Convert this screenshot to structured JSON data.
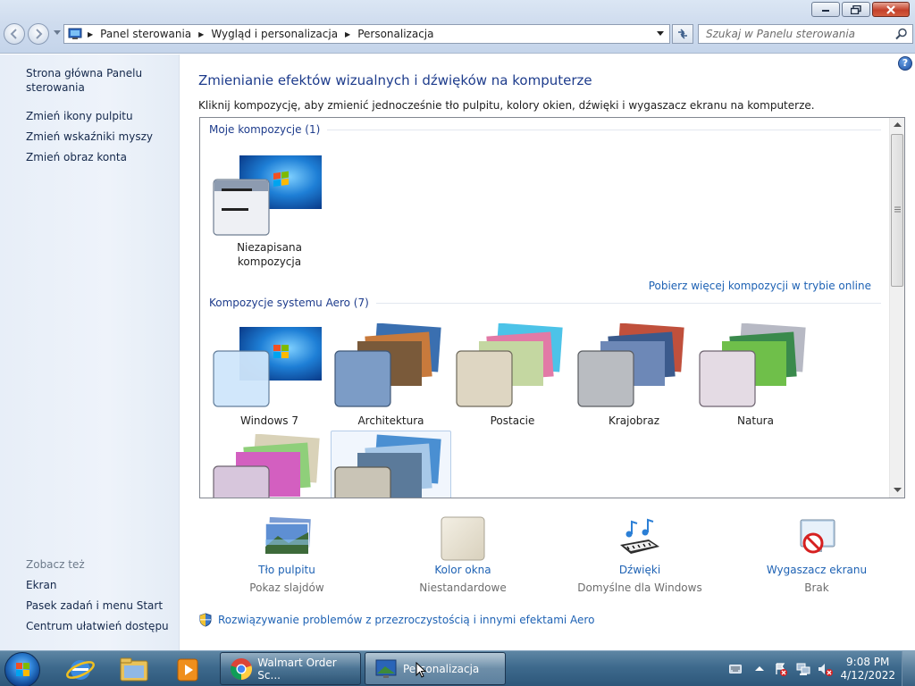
{
  "breadcrumb": {
    "items": [
      "Panel sterowania",
      "Wygląd i personalizacja",
      "Personalizacja"
    ]
  },
  "search": {
    "placeholder": "Szukaj w Panelu sterowania"
  },
  "sidebar": {
    "home_link": "Strona główna Panelu sterowania",
    "links": [
      "Zmień ikony pulpitu",
      "Zmień wskaźniki myszy",
      "Zmień obraz konta"
    ],
    "see_also_header": "Zobacz też",
    "see_also": [
      "Ekran",
      "Pasek zadań i menu Start",
      "Centrum ułatwień dostępu"
    ]
  },
  "main": {
    "title": "Zmienianie efektów wizualnych i dźwięków na komputerze",
    "subtitle": "Kliknij kompozycję, aby zmienić jednocześnie tło pulpitu, kolory okien, dźwięki i wygaszacz ekranu na komputerze.",
    "my_themes_header": "Moje kompozycje (1)",
    "my_themes": [
      {
        "label_line1": "Niezapisana",
        "label_line2": "kompozycja"
      }
    ],
    "get_more_link": "Pobierz więcej kompozycji w trybie online",
    "aero_header": "Kompozycje systemu Aero (7)",
    "aero_themes": [
      {
        "label": "Windows 7"
      },
      {
        "label": "Architektura"
      },
      {
        "label": "Postacie"
      },
      {
        "label": "Krajobraz"
      },
      {
        "label": "Natura"
      }
    ]
  },
  "bottom": [
    {
      "link": "Tło pulpitu",
      "value": "Pokaz slajdów",
      "icon": "desktop-background-icon"
    },
    {
      "link": "Kolor okna",
      "value": "Niestandardowe",
      "icon": "window-color-icon"
    },
    {
      "link": "Dźwięki",
      "value": "Domyślne dla Windows",
      "icon": "sounds-icon"
    },
    {
      "link": "Wygaszacz ekranu",
      "value": "Brak",
      "icon": "screensaver-icon"
    }
  ],
  "troubleshoot_link": "Rozwiązywanie problemów z przezroczystością i innymi efektami Aero",
  "taskbar": {
    "tasks": [
      {
        "label": "Walmart Order Sc...",
        "icon": "chrome-icon"
      },
      {
        "label": "Personalizacja",
        "icon": "personalization-icon"
      }
    ],
    "time": "9:08 PM",
    "date": "4/12/2022"
  },
  "colors": {
    "accent": "#1e3c8c",
    "link": "#1e62b4"
  }
}
